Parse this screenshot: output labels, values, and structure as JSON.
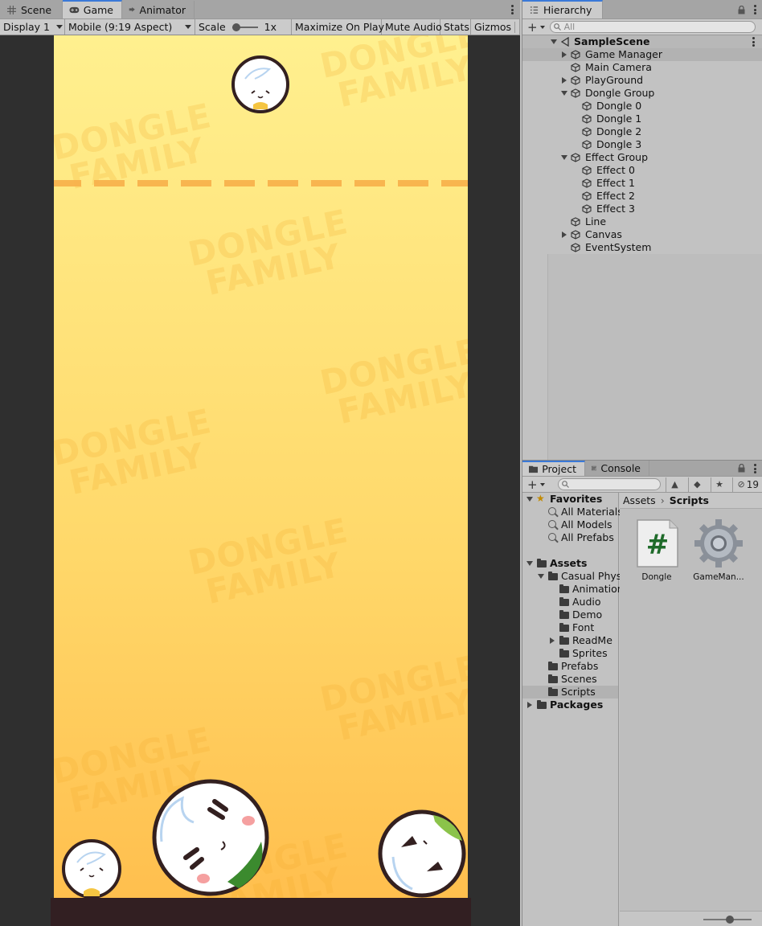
{
  "game_view": {
    "tabs": [
      {
        "label": "Scene",
        "icon": "grid-icon"
      },
      {
        "label": "Game",
        "icon": "gamepad-icon"
      },
      {
        "label": "Animator",
        "icon": "animator-icon"
      }
    ],
    "toolbar": {
      "display": "Display 1",
      "aspect": "Mobile (9:19 Aspect)",
      "scale_label": "Scale",
      "scale_value": "1x",
      "maximize": "Maximize On Play",
      "mute": "Mute Audio",
      "stats": "Stats",
      "gizmos": "Gizmos"
    },
    "watermark_line1": "DONGLE",
    "watermark_line2": "FAMILY",
    "colors": {
      "background_top": "#fff08f",
      "background_bottom": "#ffbf4e",
      "deadline": "#f8b24c",
      "ground": "#321f22"
    }
  },
  "hierarchy": {
    "tab_label": "Hierarchy",
    "search_placeholder": "All",
    "scene_name": "SampleScene",
    "items": [
      {
        "label": "Game Manager",
        "depth": 1,
        "fold": "closed",
        "selected": true
      },
      {
        "label": "Main Camera",
        "depth": 1,
        "fold": "none"
      },
      {
        "label": "PlayGround",
        "depth": 1,
        "fold": "closed"
      },
      {
        "label": "Dongle Group",
        "depth": 1,
        "fold": "open"
      },
      {
        "label": "Dongle 0",
        "depth": 2,
        "fold": "none"
      },
      {
        "label": "Dongle 1",
        "depth": 2,
        "fold": "none"
      },
      {
        "label": "Dongle 2",
        "depth": 2,
        "fold": "none"
      },
      {
        "label": "Dongle 3",
        "depth": 2,
        "fold": "none"
      },
      {
        "label": "Effect Group",
        "depth": 1,
        "fold": "open"
      },
      {
        "label": "Effect 0",
        "depth": 2,
        "fold": "none"
      },
      {
        "label": "Effect 1",
        "depth": 2,
        "fold": "none"
      },
      {
        "label": "Effect 2",
        "depth": 2,
        "fold": "none"
      },
      {
        "label": "Effect 3",
        "depth": 2,
        "fold": "none"
      },
      {
        "label": "Line",
        "depth": 1,
        "fold": "none"
      },
      {
        "label": "Canvas",
        "depth": 1,
        "fold": "closed"
      },
      {
        "label": "EventSystem",
        "depth": 1,
        "fold": "none"
      }
    ]
  },
  "project": {
    "tabs": [
      {
        "label": "Project",
        "icon": "folder-icon"
      },
      {
        "label": "Console",
        "icon": "console-icon"
      }
    ],
    "hidden_count": "19",
    "favorites_label": "Favorites",
    "favorites": [
      "All Materials",
      "All Models",
      "All Prefabs"
    ],
    "assets_label": "Assets",
    "assets_tree": [
      {
        "label": "Casual Phys",
        "depth": 1,
        "fold": "open"
      },
      {
        "label": "Animation",
        "depth": 2,
        "fold": "none"
      },
      {
        "label": "Audio",
        "depth": 2,
        "fold": "none"
      },
      {
        "label": "Demo",
        "depth": 2,
        "fold": "none"
      },
      {
        "label": "Font",
        "depth": 2,
        "fold": "none"
      },
      {
        "label": "ReadMe",
        "depth": 2,
        "fold": "closed"
      },
      {
        "label": "Sprites",
        "depth": 2,
        "fold": "none"
      },
      {
        "label": "Prefabs",
        "depth": 1,
        "fold": "none"
      },
      {
        "label": "Scenes",
        "depth": 1,
        "fold": "none"
      },
      {
        "label": "Scripts",
        "depth": 1,
        "fold": "none",
        "selected": true
      }
    ],
    "packages_label": "Packages",
    "breadcrumb": [
      "Assets",
      "Scripts"
    ],
    "files": [
      {
        "name": "Dongle",
        "icon": "csharp-script-icon"
      },
      {
        "name": "GameMan...",
        "icon": "gear-icon"
      }
    ]
  }
}
